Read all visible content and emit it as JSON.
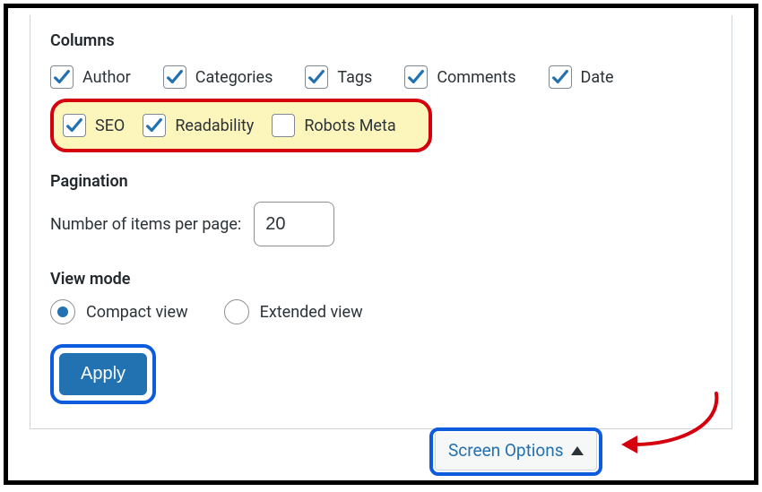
{
  "columns": {
    "title": "Columns",
    "items": [
      {
        "label": "Author",
        "checked": true
      },
      {
        "label": "Categories",
        "checked": true
      },
      {
        "label": "Tags",
        "checked": true
      },
      {
        "label": "Comments",
        "checked": true
      },
      {
        "label": "Date",
        "checked": true
      }
    ],
    "highlighted": [
      {
        "label": "SEO",
        "checked": true
      },
      {
        "label": "Readability",
        "checked": true
      },
      {
        "label": "Robots Meta",
        "checked": false
      }
    ]
  },
  "pagination": {
    "title": "Pagination",
    "label": "Number of items per page:",
    "value": "20"
  },
  "view_mode": {
    "title": "View mode",
    "options": [
      {
        "label": "Compact view",
        "selected": true
      },
      {
        "label": "Extended view",
        "selected": false
      }
    ]
  },
  "apply_label": "Apply",
  "screen_options_label": "Screen Options"
}
